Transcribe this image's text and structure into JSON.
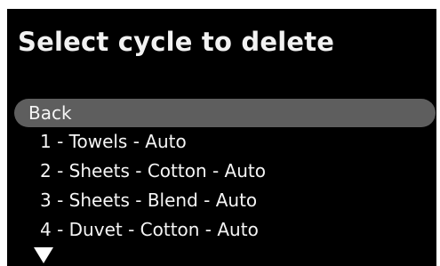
{
  "screen": {
    "title": "Select cycle to delete",
    "scroll_indicator": "down-arrow-icon"
  },
  "menu": {
    "items": [
      {
        "label": "Back",
        "selected": true
      },
      {
        "label": "1 - Towels - Auto",
        "selected": false
      },
      {
        "label": "2 - Sheets - Cotton - Auto",
        "selected": false
      },
      {
        "label": "3 - Sheets - Blend - Auto",
        "selected": false
      },
      {
        "label": "4 - Duvet - Cotton - Auto",
        "selected": false
      }
    ]
  },
  "colors": {
    "background": "#000000",
    "text": "#ffffff",
    "highlight": "#5e5e5e"
  }
}
